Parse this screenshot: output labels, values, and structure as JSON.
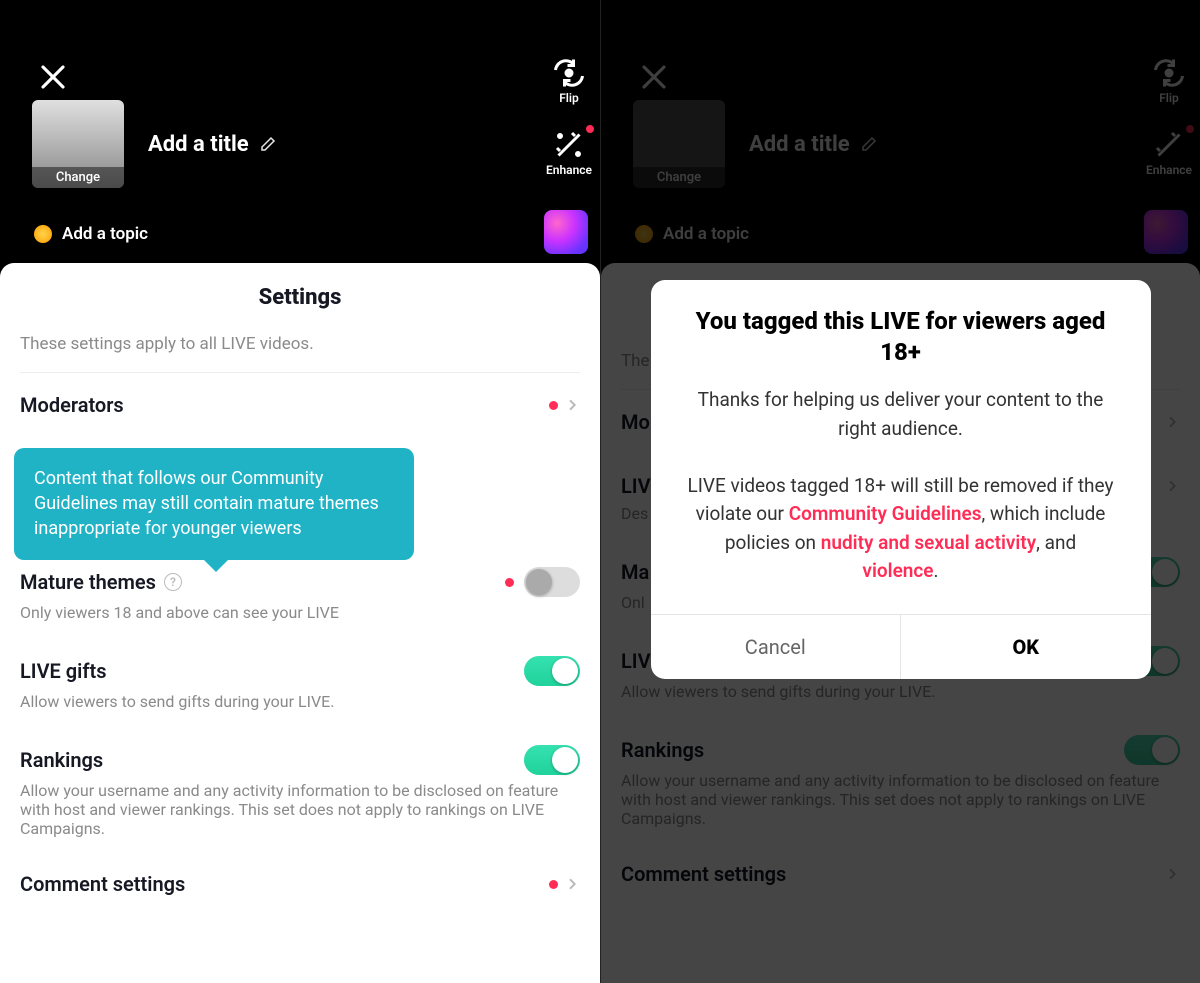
{
  "left": {
    "cover_label": "Change",
    "title_placeholder": "Add a title",
    "topic_label": "Add a topic",
    "side": {
      "flip": "Flip",
      "enhance": "Enhance"
    },
    "sheet": {
      "title": "Settings",
      "subtitle": "These settings apply to all LIVE videos.",
      "moderators": "Moderators",
      "tooltip": "Content that follows our Community Guidelines may still contain mature themes inappropriate for younger viewers",
      "mature_label": "Mature themes",
      "mature_desc": "Only viewers 18 and above can see your LIVE",
      "gifts_label": "LIVE gifts",
      "gifts_desc": "Allow viewers to send gifts during your LIVE.",
      "rankings_label": "Rankings",
      "rankings_desc": "Allow your username and any activity information to be disclosed on feature with host and viewer rankings. This set does not apply to rankings on LIVE Campaigns.",
      "comments_label": "Comment settings"
    }
  },
  "right": {
    "cover_label": "Change",
    "title_placeholder": "Add a title",
    "topic_label": "Add a topic",
    "side": {
      "flip": "Flip",
      "enhance": "Enhance"
    },
    "sheet": {
      "subtitle_prefix": "The",
      "mod_prefix": "Mo",
      "liv_prefix": "LIV",
      "liv_desc": "Des",
      "ma_prefix": "Ma",
      "onl_prefix": "Onl",
      "gifts_label": "LIVE gifts",
      "gifts_desc": "Allow viewers to send gifts during your LIVE.",
      "rankings_label": "Rankings",
      "rankings_desc": "Allow your username and any activity information to be disclosed on feature with host and viewer rankings. This set does not apply to rankings on LIVE Campaigns.",
      "comments_label": "Comment settings"
    },
    "modal": {
      "title": "You tagged this LIVE for viewers aged 18+",
      "p1": "Thanks for helping us deliver your content to the right audience.",
      "p2a": "LIVE videos tagged 18+ will still be removed if they violate our ",
      "cg": "Community Guidelines",
      "p2b": ", which include policies on ",
      "nsa": "nudity and sexual activity",
      "and": ", and ",
      "viol": "violence",
      "dot": ".",
      "cancel": "Cancel",
      "ok": "OK"
    }
  }
}
